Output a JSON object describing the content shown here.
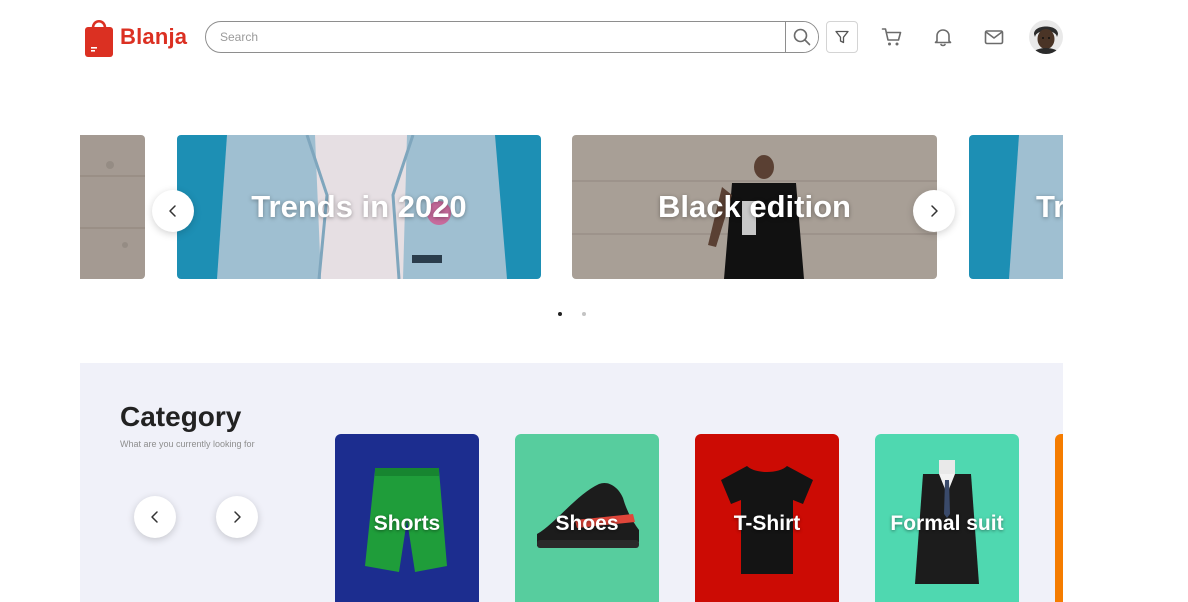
{
  "brand": {
    "name": "Blanja",
    "color": "#db3022"
  },
  "search": {
    "placeholder": "Search",
    "value": ""
  },
  "header_icons": [
    "search-icon",
    "filter-icon",
    "cart-icon",
    "bell-icon",
    "mail-icon"
  ],
  "carousel": {
    "slides": [
      {
        "label": "",
        "theme": "concrete"
      },
      {
        "label": "Trends in 2020",
        "theme": "denim"
      },
      {
        "label": "Black edition",
        "theme": "concrete"
      },
      {
        "label": "Tr",
        "theme": "denim"
      }
    ],
    "active_page": 1,
    "page_count": 2
  },
  "category": {
    "title": "Category",
    "subtitle": "What are you currently looking for",
    "items": [
      {
        "label": "Shorts",
        "color": "#1c2d8f"
      },
      {
        "label": "Shoes",
        "color": "#57cd9e"
      },
      {
        "label": "T-Shirt",
        "color": "#cc0b04"
      },
      {
        "label": "Formal suit",
        "color": "#4fd8b0"
      },
      {
        "label": "",
        "color": "#f57c00"
      }
    ]
  }
}
